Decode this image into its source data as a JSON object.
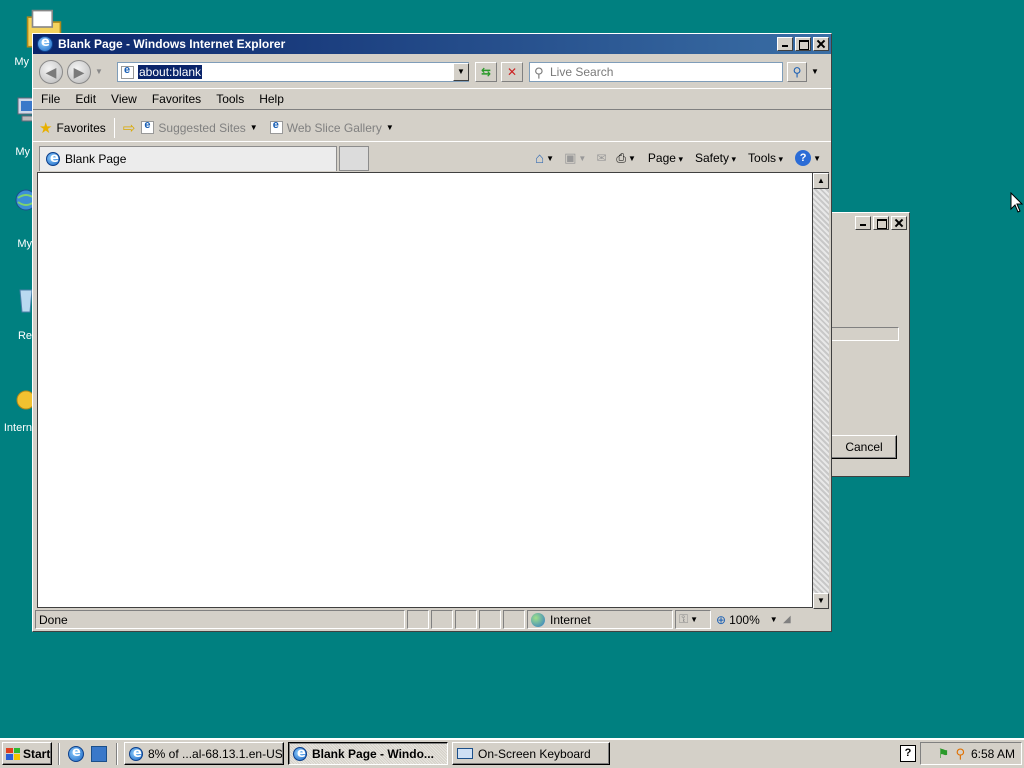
{
  "desktop": {
    "background_color": "#008080",
    "icons": [
      {
        "name": "folder-icon",
        "label": "My D"
      },
      {
        "name": "computer-icon",
        "label": "My"
      },
      {
        "name": "network-icon",
        "label": "My"
      },
      {
        "name": "recycle-bin-icon",
        "label": "Re"
      },
      {
        "name": "internet-explorer-icon",
        "label": "Intern"
      }
    ]
  },
  "bg_dialog": {
    "cancel_label": "Cancel"
  },
  "ie": {
    "title": "Blank Page - Windows Internet Explorer",
    "address_value": "about:blank",
    "search_placeholder": "Live Search",
    "menu": [
      "File",
      "Edit",
      "View",
      "Favorites",
      "Tools",
      "Help"
    ],
    "favorites": {
      "label": "Favorites",
      "suggested_sites": "Suggested Sites",
      "web_slice_gallery": "Web Slice Gallery"
    },
    "tab_label": "Blank Page",
    "commands": {
      "page": "Page",
      "safety": "Safety",
      "tools": "Tools"
    },
    "status": {
      "text": "Done",
      "zone": "Internet",
      "zoom": "100%"
    }
  },
  "taskbar": {
    "start_label": "Start",
    "buttons": [
      {
        "label": "8% of ...al-68.13.1.en-US....",
        "active": false
      },
      {
        "label": "Blank Page - Windo...",
        "active": true
      },
      {
        "label": "On-Screen Keyboard",
        "active": false
      }
    ],
    "clock": "6:58 AM"
  }
}
